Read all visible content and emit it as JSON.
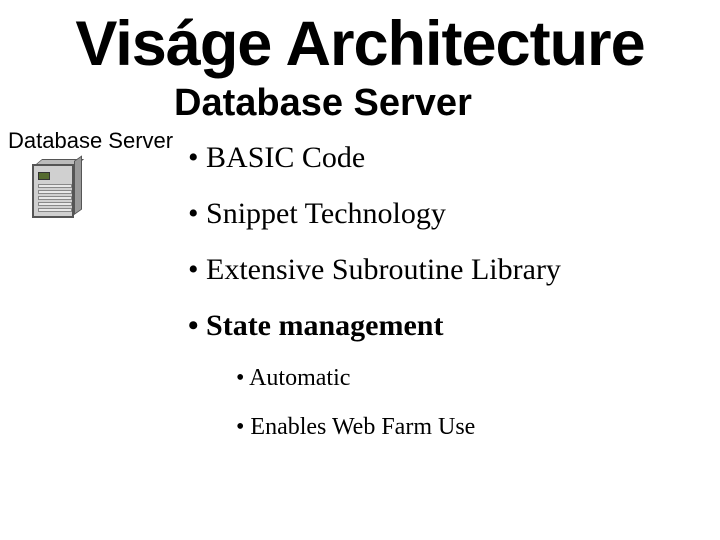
{
  "title": "Viságe Architecture",
  "left_label": "Database Server",
  "heading": "Database Server",
  "bullets": [
    {
      "text": "BASIC Code",
      "bold": false
    },
    {
      "text": "Snippet Technology",
      "bold": false
    },
    {
      "text": "Extensive Subroutine Library",
      "bold": false
    },
    {
      "text": "State management",
      "bold": true
    }
  ],
  "sub_bullets": [
    {
      "text": "Automatic"
    },
    {
      "text": "Enables Web Farm Use"
    }
  ]
}
